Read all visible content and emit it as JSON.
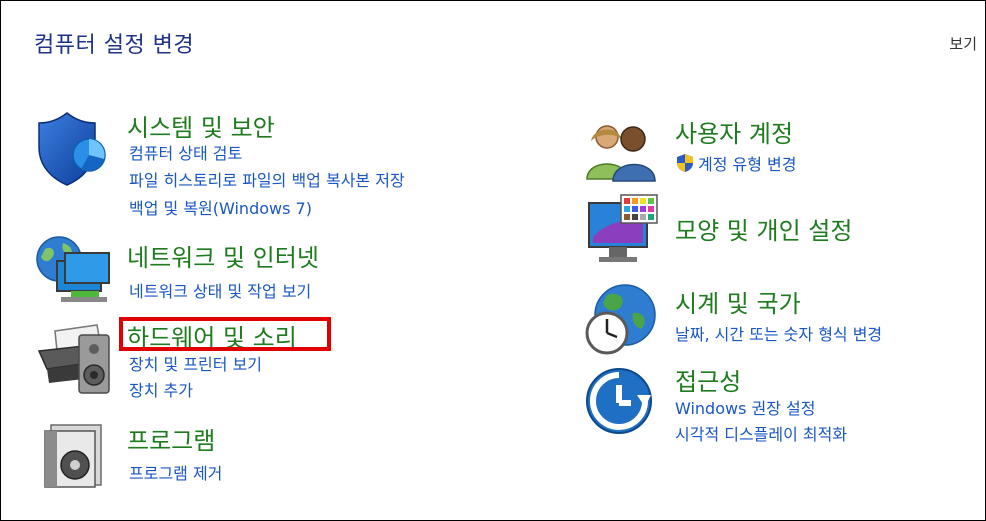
{
  "header": {
    "title": "컴퓨터 설정 변경",
    "view_by": "보기"
  },
  "left_column": [
    {
      "title": "시스템 및 보안",
      "icon": "security-shield-icon",
      "links": [
        "컴퓨터 상태 검토",
        "파일 히스토리로 파일의 백업 복사본 저장",
        "백업 및 복원(Windows 7)"
      ]
    },
    {
      "title": "네트워크 및 인터넷",
      "icon": "network-globe-icon",
      "links": [
        "네트워크 상태 및 작업 보기"
      ]
    },
    {
      "title": "하드웨어 및 소리",
      "icon": "printer-speaker-icon",
      "highlighted": true,
      "links": [
        "장치 및 프린터 보기",
        "장치 추가"
      ]
    },
    {
      "title": "프로그램",
      "icon": "program-disc-icon",
      "links": [
        "프로그램 제거"
      ]
    }
  ],
  "right_column": [
    {
      "title": "사용자 계정",
      "icon": "users-icon",
      "links": [
        "계정 유형 변경"
      ],
      "link_icon": "uac-shield-icon"
    },
    {
      "title": "모양 및 개인 설정",
      "icon": "display-palette-icon",
      "links": []
    },
    {
      "title": "시계 및 국가",
      "icon": "clock-globe-icon",
      "links": [
        "날짜, 시간 또는 숫자 형식 변경"
      ]
    },
    {
      "title": "접근성",
      "icon": "ease-of-access-icon",
      "links": [
        "Windows 권장 설정",
        "시각적 디스플레이 최적화"
      ]
    }
  ],
  "colors": {
    "title_blue": "#1e3287",
    "category_green": "#1e7b1e",
    "link_blue": "#1a56c4",
    "highlight_red": "#e00000"
  }
}
